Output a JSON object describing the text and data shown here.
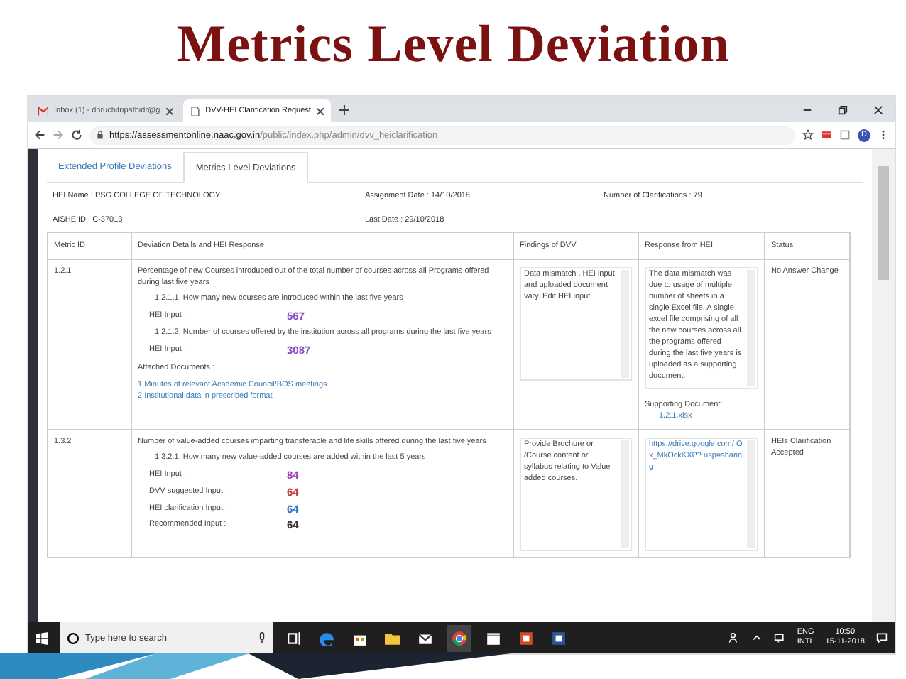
{
  "slide_title": "Metrics Level Deviation",
  "browser": {
    "tabs": [
      {
        "title": "Inbox (1) - dhruchitripathidr@g",
        "selected": false
      },
      {
        "title": "DVV-HEI Clarification Request",
        "selected": true
      }
    ],
    "url_host": "https://assessmentonline.naac.gov.in",
    "url_path": "/public/index.php/admin/dvv_heiclarification",
    "profile_initial": "D"
  },
  "page": {
    "tabs": [
      {
        "label": "Extended Profile Deviations",
        "selected": false
      },
      {
        "label": "Metrics Level Deviations",
        "selected": true
      }
    ],
    "info": [
      [
        "HEI Name : PSG COLLEGE OF TECHNOLOGY",
        "Assignment Date : 14/10/2018",
        "Number of Clarifications : 79"
      ],
      [
        "AISHE ID : C-37013",
        "Last Date : 29/10/2018"
      ]
    ],
    "columns": [
      "Metric ID",
      "Deviation Details and HEI Response",
      "Findings of DVV",
      "Response from HEI",
      "Status"
    ],
    "rows": [
      {
        "metric_id": "1.2.1",
        "question": "Percentage of new Courses introduced out of the total number of courses across all Programs offered during last five years",
        "items": [
          {
            "kind": "question",
            "text": "1.2.1.1. How many new courses are introduced within the last five years"
          },
          {
            "kind": "input",
            "label": "HEI Input :",
            "value": "567",
            "color": "#8a4fc7"
          },
          {
            "kind": "question",
            "text": "1.2.1.2. Number of courses offered by the institution across all programs during the last five years"
          },
          {
            "kind": "input",
            "label": "HEI Input :",
            "value": "3087",
            "color": "#8a4fc7"
          }
        ],
        "attachments_label": "Attached Documents :",
        "attachments": [
          "1.Minutes of relevant Academic Council/BOS meetings",
          "2.Institutional data in prescribed format"
        ],
        "findings": "Data mismatch . HEI input and uploaded document vary. Edit HEI input.",
        "response": {
          "kind": "text",
          "text": "The data mismatch was due to usage of multiple number of sheets in a single Excel file. A single excel file comprising of all the new courses across all the programs offered during the last five years is uploaded as a supporting document."
        },
        "supporting_label": "Supporting Document:",
        "supporting_file": "1.2.1.xlsx",
        "status": "No Answer Change"
      },
      {
        "metric_id": "1.3.2",
        "question": "Number of value-added courses imparting transferable and life skills offered during the last five years",
        "items": [
          {
            "kind": "question",
            "text": "1.3.2.1. How many new value-added courses are added within the last 5 years"
          },
          {
            "kind": "input",
            "label": "HEI Input :",
            "value": "84",
            "color": "#a23bb5"
          },
          {
            "kind": "input",
            "label": "DVV suggested Input :",
            "value": "64",
            "color": "#c0392b"
          },
          {
            "kind": "input",
            "label": "HEI clarification Input :",
            "value": "64",
            "color": "#2f6fc0"
          },
          {
            "kind": "input",
            "label": "Recommended Input :",
            "value": "64",
            "color": "#333333"
          }
        ],
        "findings": "Provide Brochure or /Course content or syllabus relating to Value added courses.",
        "response": {
          "kind": "link",
          "text": "https://drive.google.com/ Ox_MkOckKXP? usp=sharing"
        },
        "status": "HEIs Clarification Accepted"
      }
    ]
  },
  "taskbar": {
    "search_placeholder": "Type here to search",
    "lang_top": "ENG",
    "lang_bottom": "INTL",
    "time": "10:50",
    "date": "15-11-2018"
  }
}
